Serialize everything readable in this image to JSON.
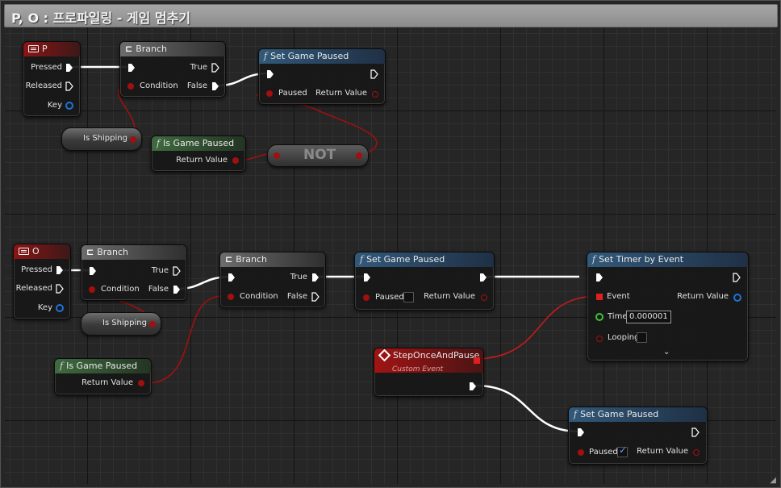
{
  "window": {
    "title": "P, O : 프로파일링 - 게임 멈추기"
  },
  "graph": {
    "input_p": {
      "title": "P",
      "pressed": "Pressed",
      "released": "Released",
      "key": "Key"
    },
    "branch_1": {
      "title": "Branch",
      "true": "True",
      "false": "False",
      "condition": "Condition"
    },
    "set_paused_1": {
      "title": "Set Game Paused",
      "paused": "Paused",
      "return": "Return Value"
    },
    "is_shipping_1": {
      "label": "Is Shipping"
    },
    "is_paused_1": {
      "title": "Is Game Paused",
      "return": "Return Value"
    },
    "not_node": {
      "label": "NOT"
    },
    "input_o": {
      "title": "O",
      "pressed": "Pressed",
      "released": "Released",
      "key": "Key"
    },
    "branch_2": {
      "title": "Branch",
      "true": "True",
      "false": "False",
      "condition": "Condition"
    },
    "branch_3": {
      "title": "Branch",
      "true": "True",
      "false": "False",
      "condition": "Condition"
    },
    "set_paused_2": {
      "title": "Set Game Paused",
      "paused": "Paused",
      "return": "Return Value",
      "paused_checked": false
    },
    "is_shipping_2": {
      "label": "Is Shipping"
    },
    "is_paused_2": {
      "title": "Is Game Paused",
      "return": "Return Value"
    },
    "set_timer": {
      "title": "Set Timer by Event",
      "event": "Event",
      "return": "Return Value",
      "time": "Time",
      "time_value": "0.000001",
      "looping": "Looping",
      "looping_checked": false
    },
    "step_event": {
      "title": "StepOnceAndPause",
      "subtitle": "Custom Event"
    },
    "set_paused_3": {
      "title": "Set Game Paused",
      "paused": "Paused",
      "return": "Return Value",
      "paused_checked": true
    }
  },
  "colors": {
    "exec_wire": "#ffffff",
    "bool_wire": "#a01010",
    "event_wire": "#c81a1a",
    "header_function": "#32597a",
    "header_pure": "#3f6b3f",
    "header_input": "#8c1515"
  }
}
